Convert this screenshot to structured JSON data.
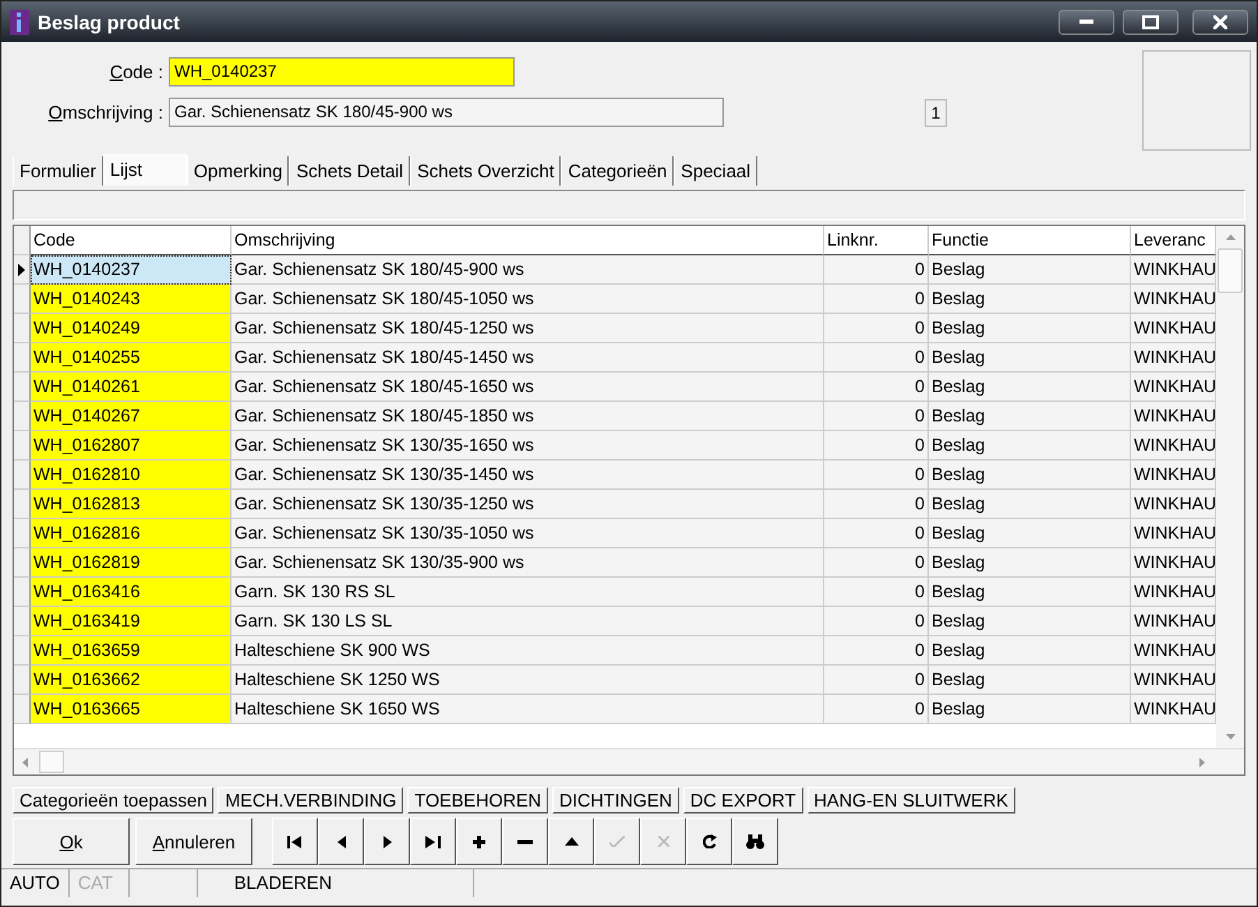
{
  "window": {
    "title": "Beslag product"
  },
  "header": {
    "code_label": "Code :",
    "code_value": "WH_0140237",
    "description_label": "Omschrijving :",
    "description_value": "Gar. Schienensatz SK 180/45-900 ws",
    "count": "1"
  },
  "tabs": [
    {
      "label": "Formulier",
      "selected": false
    },
    {
      "label": "Lijst",
      "selected": true
    },
    {
      "label": "Opmerking",
      "selected": false
    },
    {
      "label": "Schets Detail",
      "selected": false
    },
    {
      "label": "Schets Overzicht",
      "selected": false
    },
    {
      "label": "Categorieën",
      "selected": false
    },
    {
      "label": "Speciaal",
      "selected": false
    }
  ],
  "table": {
    "columns": [
      "Code",
      "Omschrijving",
      "Linknr.",
      "Functie",
      "Leveranc"
    ],
    "rows": [
      {
        "selected": true,
        "cells": [
          "WH_0140237",
          "Gar. Schienensatz SK 180/45-900 ws",
          "0",
          "Beslag",
          "WINKHAU"
        ]
      },
      {
        "selected": false,
        "cells": [
          "WH_0140243",
          "Gar. Schienensatz SK 180/45-1050 ws",
          "0",
          "Beslag",
          "WINKHAU"
        ]
      },
      {
        "selected": false,
        "cells": [
          "WH_0140249",
          "Gar. Schienensatz SK 180/45-1250 ws",
          "0",
          "Beslag",
          "WINKHAU"
        ]
      },
      {
        "selected": false,
        "cells": [
          "WH_0140255",
          "Gar. Schienensatz SK 180/45-1450 ws",
          "0",
          "Beslag",
          "WINKHAU"
        ]
      },
      {
        "selected": false,
        "cells": [
          "WH_0140261",
          "Gar. Schienensatz SK 180/45-1650 ws",
          "0",
          "Beslag",
          "WINKHAU"
        ]
      },
      {
        "selected": false,
        "cells": [
          "WH_0140267",
          "Gar. Schienensatz SK 180/45-1850 ws",
          "0",
          "Beslag",
          "WINKHAU"
        ]
      },
      {
        "selected": false,
        "cells": [
          "WH_0162807",
          "Gar. Schienensatz SK 130/35-1650 ws",
          "0",
          "Beslag",
          "WINKHAU"
        ]
      },
      {
        "selected": false,
        "cells": [
          "WH_0162810",
          "Gar. Schienensatz SK 130/35-1450 ws",
          "0",
          "Beslag",
          "WINKHAU"
        ]
      },
      {
        "selected": false,
        "cells": [
          "WH_0162813",
          "Gar. Schienensatz SK 130/35-1250 ws",
          "0",
          "Beslag",
          "WINKHAU"
        ]
      },
      {
        "selected": false,
        "cells": [
          "WH_0162816",
          "Gar. Schienensatz SK 130/35-1050 ws",
          "0",
          "Beslag",
          "WINKHAU"
        ]
      },
      {
        "selected": false,
        "cells": [
          "WH_0162819",
          "Gar. Schienensatz SK 130/35-900 ws",
          "0",
          "Beslag",
          "WINKHAU"
        ]
      },
      {
        "selected": false,
        "cells": [
          "WH_0163416",
          "Garn. SK 130 RS SL",
          "0",
          "Beslag",
          "WINKHAU"
        ]
      },
      {
        "selected": false,
        "cells": [
          "WH_0163419",
          "Garn. SK 130 LS SL",
          "0",
          "Beslag",
          "WINKHAU"
        ]
      },
      {
        "selected": false,
        "cells": [
          "WH_0163659",
          "Halteschiene SK 900 WS",
          "0",
          "Beslag",
          "WINKHAU"
        ]
      },
      {
        "selected": false,
        "cells": [
          "WH_0163662",
          "Halteschiene SK 1250 WS",
          "0",
          "Beslag",
          "WINKHAU"
        ]
      },
      {
        "selected": false,
        "cells": [
          "WH_0163665",
          "Halteschiene SK 1650 WS",
          "0",
          "Beslag",
          "WINKHAU"
        ]
      }
    ]
  },
  "category_buttons": [
    "Categorieën toepassen",
    "MECH.VERBINDING",
    "TOEBEHOREN",
    "DICHTINGEN",
    "DC EXPORT",
    "HANG-EN SLUITWERK"
  ],
  "buttons": [
    "Ok",
    "Annuleren"
  ],
  "navigator": [
    {
      "kind": "first",
      "disabled": false
    },
    {
      "kind": "prior",
      "disabled": false
    },
    {
      "kind": "next",
      "disabled": false
    },
    {
      "kind": "last",
      "disabled": false
    },
    {
      "kind": "insert",
      "disabled": false
    },
    {
      "kind": "delete",
      "disabled": false
    },
    {
      "kind": "edit",
      "disabled": false
    },
    {
      "kind": "post",
      "disabled": true
    },
    {
      "kind": "cancel",
      "disabled": true
    },
    {
      "kind": "refresh",
      "disabled": false
    },
    {
      "kind": "find",
      "disabled": false
    }
  ],
  "status_bar": [
    {
      "kind": "text",
      "text": "AUTO",
      "disabled": false
    },
    {
      "kind": "text",
      "text": "CAT",
      "disabled": true
    },
    {
      "kind": "blank"
    },
    {
      "kind": "text",
      "text": "BLADEREN",
      "disabled": false
    }
  ]
}
